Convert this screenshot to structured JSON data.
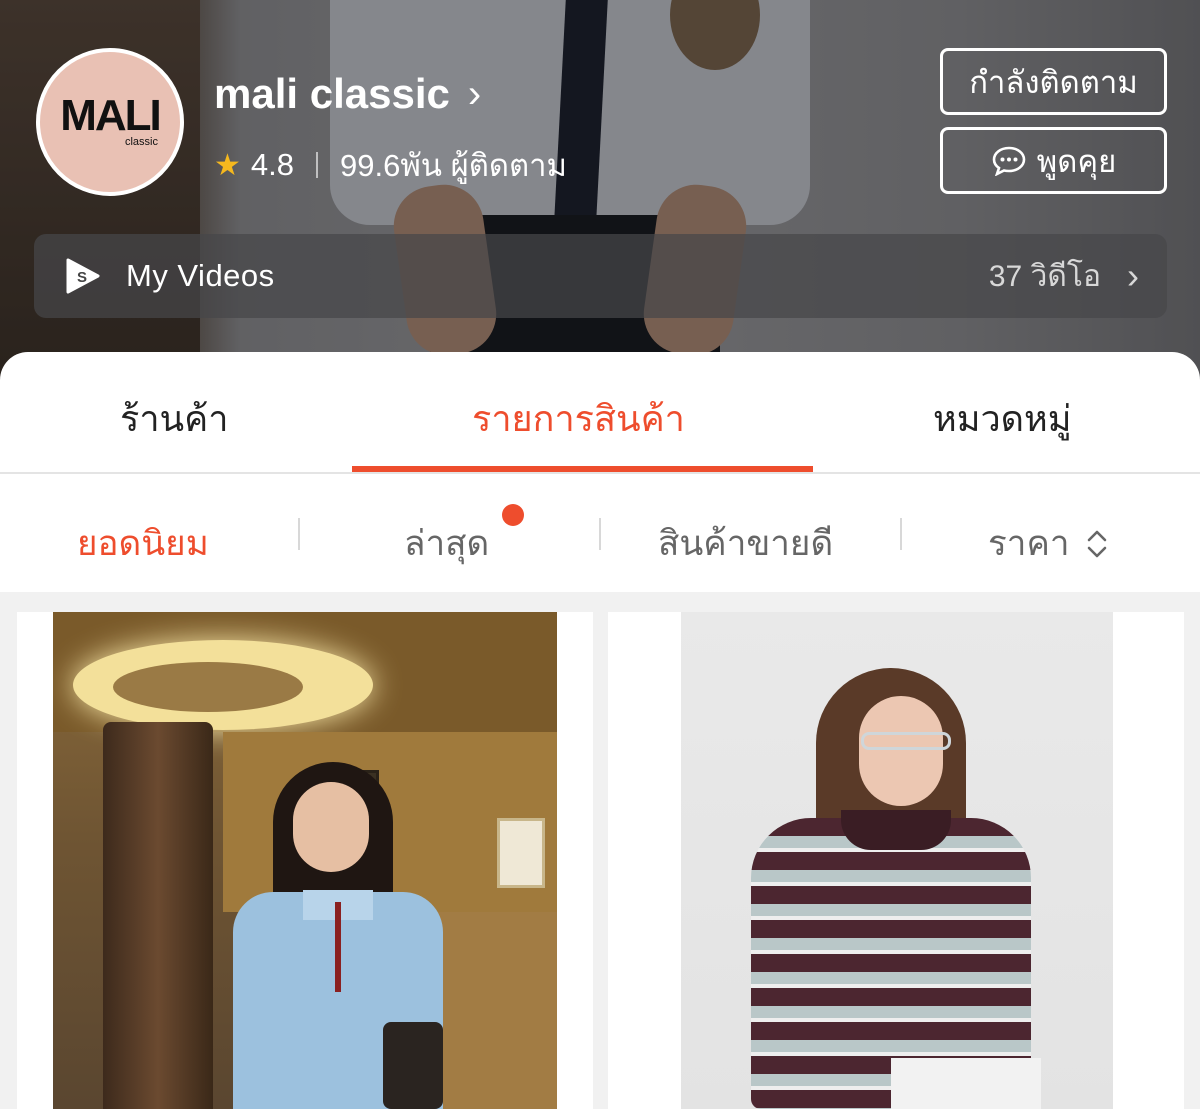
{
  "shop": {
    "logo_text": "MALI",
    "logo_subtext": "classic",
    "name": "mali classic",
    "name_chevron": "›",
    "rating": "4.8",
    "followers": "99.6พัน ผู้ติดตาม",
    "follow_button": "กำลังติดตาม",
    "chat_button": "พูดคุย"
  },
  "videos": {
    "title": "My Videos",
    "count": "37 วิดีโอ",
    "chevron": "›"
  },
  "tabs": [
    {
      "label": "ร้านค้า",
      "active": false
    },
    {
      "label": "รายการสินค้า",
      "active": true
    },
    {
      "label": "หมวดหมู่",
      "active": false
    }
  ],
  "sort": {
    "popular": "ยอดนิยม",
    "latest": "ล่าสุด",
    "best_selling": "สินค้าขายดี",
    "price": "ราคา"
  },
  "colors": {
    "accent": "#ee4d2d",
    "star": "#f5b81e",
    "avatar_bg": "#e9c1b4"
  },
  "icons": {
    "rating": "star-icon",
    "chat": "chat-bubble-icon",
    "videos": "shopee-video-icon",
    "price_sort": "sort-updown-icon"
  },
  "products": [
    {
      "image": "woman-in-light-blue-knit-cardigan-in-lobby"
    },
    {
      "image": "woman-in-striped-burgundy-knit-top"
    }
  ]
}
